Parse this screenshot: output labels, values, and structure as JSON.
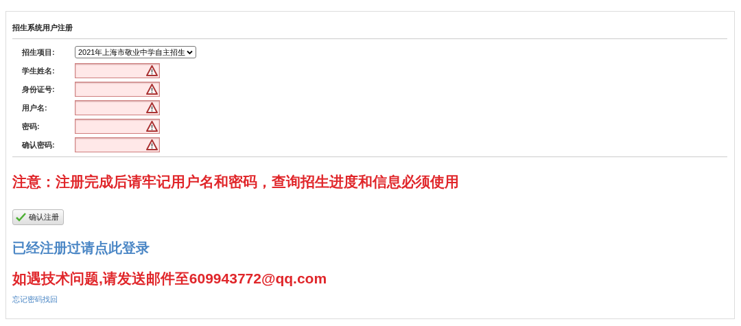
{
  "title": "招生系统用户注册",
  "fields": [
    {
      "label": "招生项目:",
      "kind": "select",
      "value": "2021年上海市敬业中学自主招生"
    },
    {
      "label": "学生姓名:",
      "kind": "text",
      "invalid": true
    },
    {
      "label": "身份证号:",
      "kind": "text",
      "invalid": true
    },
    {
      "label": "用户名:",
      "kind": "text",
      "invalid": true
    },
    {
      "label": "密码:",
      "kind": "password",
      "invalid": true
    },
    {
      "label": "确认密码:",
      "kind": "password",
      "invalid": true
    }
  ],
  "notice": "注意：注册完成后请牢记用户名和密码，查询招生进度和信息必须使用",
  "submit_button": "确认注册",
  "login_link": "已经注册过请点此登录",
  "contact": "如遇技术问题,请发送邮件至609943772@qq.com",
  "forgot_link": "忘记密码找回"
}
